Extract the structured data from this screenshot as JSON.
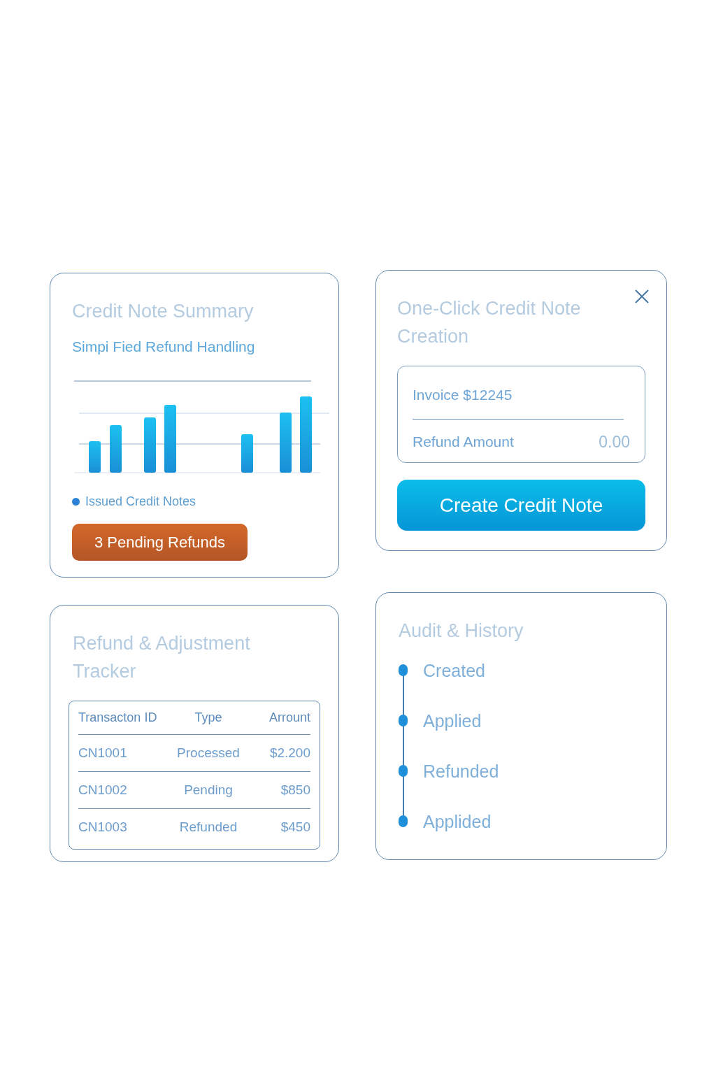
{
  "summary_card": {
    "title": "Credit Note Summary",
    "subtitle": "Simpi Fied Refund Handling",
    "legend": "Issued Credit Notes",
    "badge": "3 Pending Refunds"
  },
  "creation_card": {
    "title": "One-Click Credit Note Creation",
    "invoice": "Invoice $12245",
    "refund_label": "Refund Amount",
    "refund_value": "0.00",
    "button": "Create Credit Note"
  },
  "tracker_card": {
    "title": "Refund & Adjustment Tracker",
    "table": {
      "columns": [
        "Transacton ID",
        "Type",
        "Arrount"
      ],
      "rows": [
        [
          "CN1001",
          "Processed",
          "$2.200"
        ],
        [
          "CN1002",
          "Pending",
          "$850"
        ],
        [
          "CN1003",
          "Refunded",
          "$450"
        ]
      ]
    }
  },
  "audit_card": {
    "title": "Audit & History",
    "events": [
      "Created",
      "Applied",
      "Refunded",
      "Applided"
    ]
  }
}
